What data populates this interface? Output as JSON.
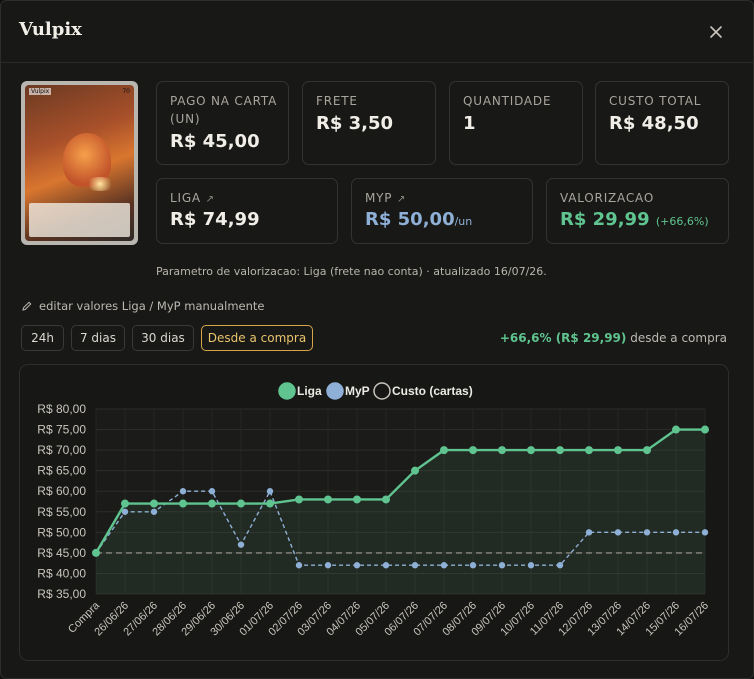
{
  "title": "Vulpix",
  "card": {
    "name": "Vulpix",
    "hp": "70"
  },
  "stats": {
    "pago": {
      "label": "PAGO NA CARTA (UN)",
      "value": "R$ 45,00"
    },
    "frete": {
      "label": "FRETE",
      "value": "R$ 3,50"
    },
    "quantidade": {
      "label": "QUANTIDADE",
      "value": "1"
    },
    "custo_total": {
      "label": "CUSTO TOTAL",
      "value": "R$ 48,50"
    },
    "liga": {
      "label": "LIGA",
      "link_icon": "↗",
      "value": "R$ 74,99"
    },
    "myp": {
      "label": "MYP",
      "link_icon": "↗",
      "value": "R$ 50,00",
      "unit": "/un"
    },
    "valorizacao": {
      "label": "VALORIZACAO",
      "value": "R$ 29,99",
      "pct": "(+66,6%)"
    }
  },
  "param_text": "Parametro de valorizacao: Liga (frete nao conta) · atualizado 16/07/26.",
  "edit_label": "editar valores Liga / MyP manualmente",
  "tabs": [
    "24h",
    "7 dias",
    "30 dias",
    "Desde a compra"
  ],
  "active_tab": "Desde a compra",
  "since": {
    "value": "+66,6% (R$ 29,99)",
    "suffix": "desde a compra"
  },
  "colors": {
    "liga": "#5fc48f",
    "myp": "#8fb0d6",
    "accent": "#d6a44a",
    "custo": "#8a8780"
  },
  "chart_data": {
    "type": "line",
    "categories": [
      "Compra",
      "26/06/26",
      "27/06/26",
      "28/06/26",
      "29/06/26",
      "30/06/26",
      "01/07/26",
      "02/07/26",
      "03/07/26",
      "04/07/26",
      "05/07/26",
      "06/07/26",
      "07/07/26",
      "08/07/26",
      "09/07/26",
      "10/07/26",
      "11/07/26",
      "12/07/26",
      "13/07/26",
      "14/07/26",
      "15/07/26",
      "16/07/26"
    ],
    "series": [
      {
        "name": "Liga",
        "values": [
          45,
          57,
          57,
          57,
          57,
          57,
          57,
          58,
          58,
          58,
          58,
          65,
          70,
          70,
          70,
          70,
          70,
          70,
          70,
          70,
          75,
          75
        ]
      },
      {
        "name": "MyP",
        "values": [
          45,
          55,
          55,
          60,
          60,
          47,
          60,
          42,
          42,
          42,
          42,
          42,
          42,
          42,
          42,
          42,
          42,
          50,
          50,
          50,
          50,
          50
        ]
      },
      {
        "name": "Custo (cartas)",
        "values": [
          45,
          45,
          45,
          45,
          45,
          45,
          45,
          45,
          45,
          45,
          45,
          45,
          45,
          45,
          45,
          45,
          45,
          45,
          45,
          45,
          45,
          45
        ]
      }
    ],
    "yticks": [
      "R$ 35,00",
      "R$ 40,00",
      "R$ 45,00",
      "R$ 50,00",
      "R$ 55,00",
      "R$ 60,00",
      "R$ 65,00",
      "R$ 70,00",
      "R$ 75,00",
      "R$ 80,00"
    ],
    "ylim": [
      35,
      80
    ],
    "legend_position": "top-center",
    "grid": true
  }
}
